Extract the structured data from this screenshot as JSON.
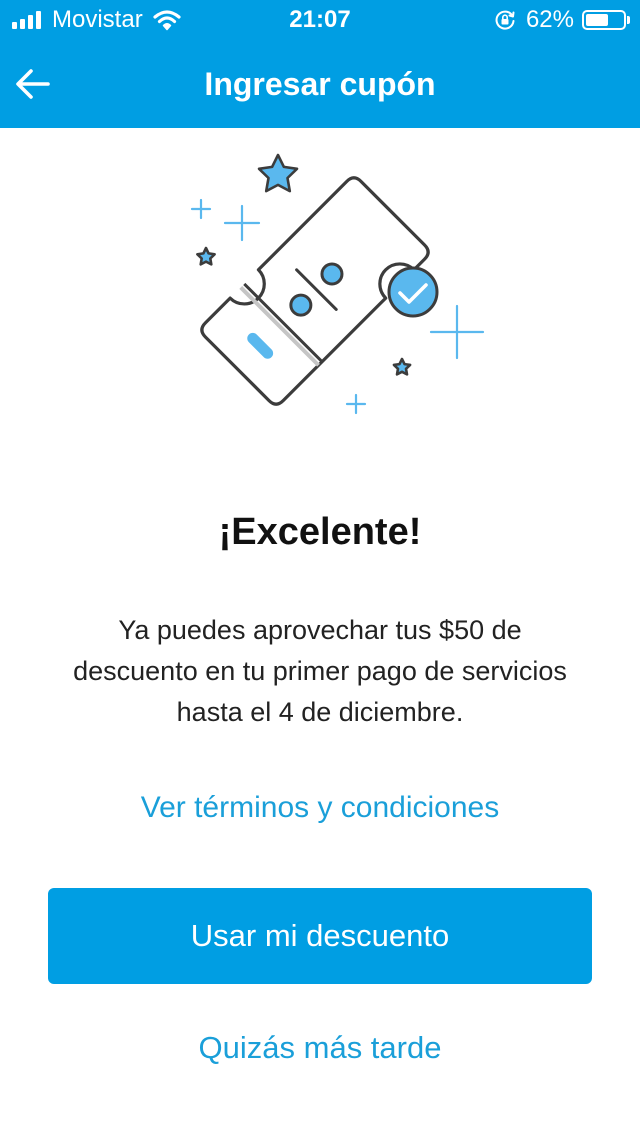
{
  "status_bar": {
    "carrier": "Movistar",
    "time": "21:07",
    "battery_percent": "62%",
    "battery_level": 0.62,
    "signal_icon": "cellular-signal-icon",
    "wifi_icon": "wifi-icon",
    "lock_icon": "rotation-lock-icon"
  },
  "header": {
    "title": "Ingresar cupón",
    "back_icon": "arrow-left-icon",
    "background_color": "#009EE3"
  },
  "illustration": {
    "icon": "discount-coupon-check-icon",
    "accent_color": "#5AB8EE",
    "line_color": "#3C3C3C"
  },
  "content": {
    "headline": "¡Excelente!",
    "message": "Ya puedes aprovechar tus $50 de descuento en tu primer pago de servicios hasta el 4 de diciembre.",
    "terms_link": "Ver términos y condiciones"
  },
  "actions": {
    "primary_label": "Usar mi descuento",
    "secondary_label": "Quizás más tarde",
    "primary_color": "#009EE3",
    "link_color": "#1A9FD9"
  }
}
